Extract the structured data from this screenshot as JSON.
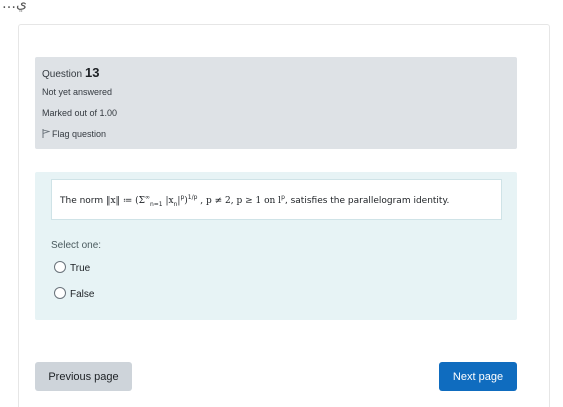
{
  "header": {
    "partial_text": "…ي"
  },
  "question_info": {
    "label": "Question",
    "number": "13",
    "state": "Not yet answered",
    "grade": "Marked out of 1.00",
    "flag_label": "Flag question",
    "flag_icon": "flag-icon"
  },
  "question": {
    "text_prefix": "The norm ",
    "norm_symbol": "‖x‖ ≔ (Σ",
    "sum_upper": "∞",
    "sum_lower": "n=1",
    "sum_body": " |x",
    "sub_n": "n",
    "power_p": "|",
    "exp_p": "p",
    "close": ")",
    "outer_exp": "1/p",
    "condition": " , p ≠ 2, p ≥ 1 on l",
    "space_exp": "p",
    "text_suffix": ", satisfies the parallelogram identity.",
    "prompt": "Select one:",
    "options": [
      {
        "label": "True",
        "selected": false
      },
      {
        "label": "False",
        "selected": false
      }
    ]
  },
  "navigation": {
    "previous_label": "Previous page",
    "next_label": "Next page"
  },
  "colors": {
    "info_bg": "#dee2e6",
    "formulation_bg": "#e7f3f5",
    "primary": "#0f6cbf",
    "secondary": "#ced4da"
  }
}
